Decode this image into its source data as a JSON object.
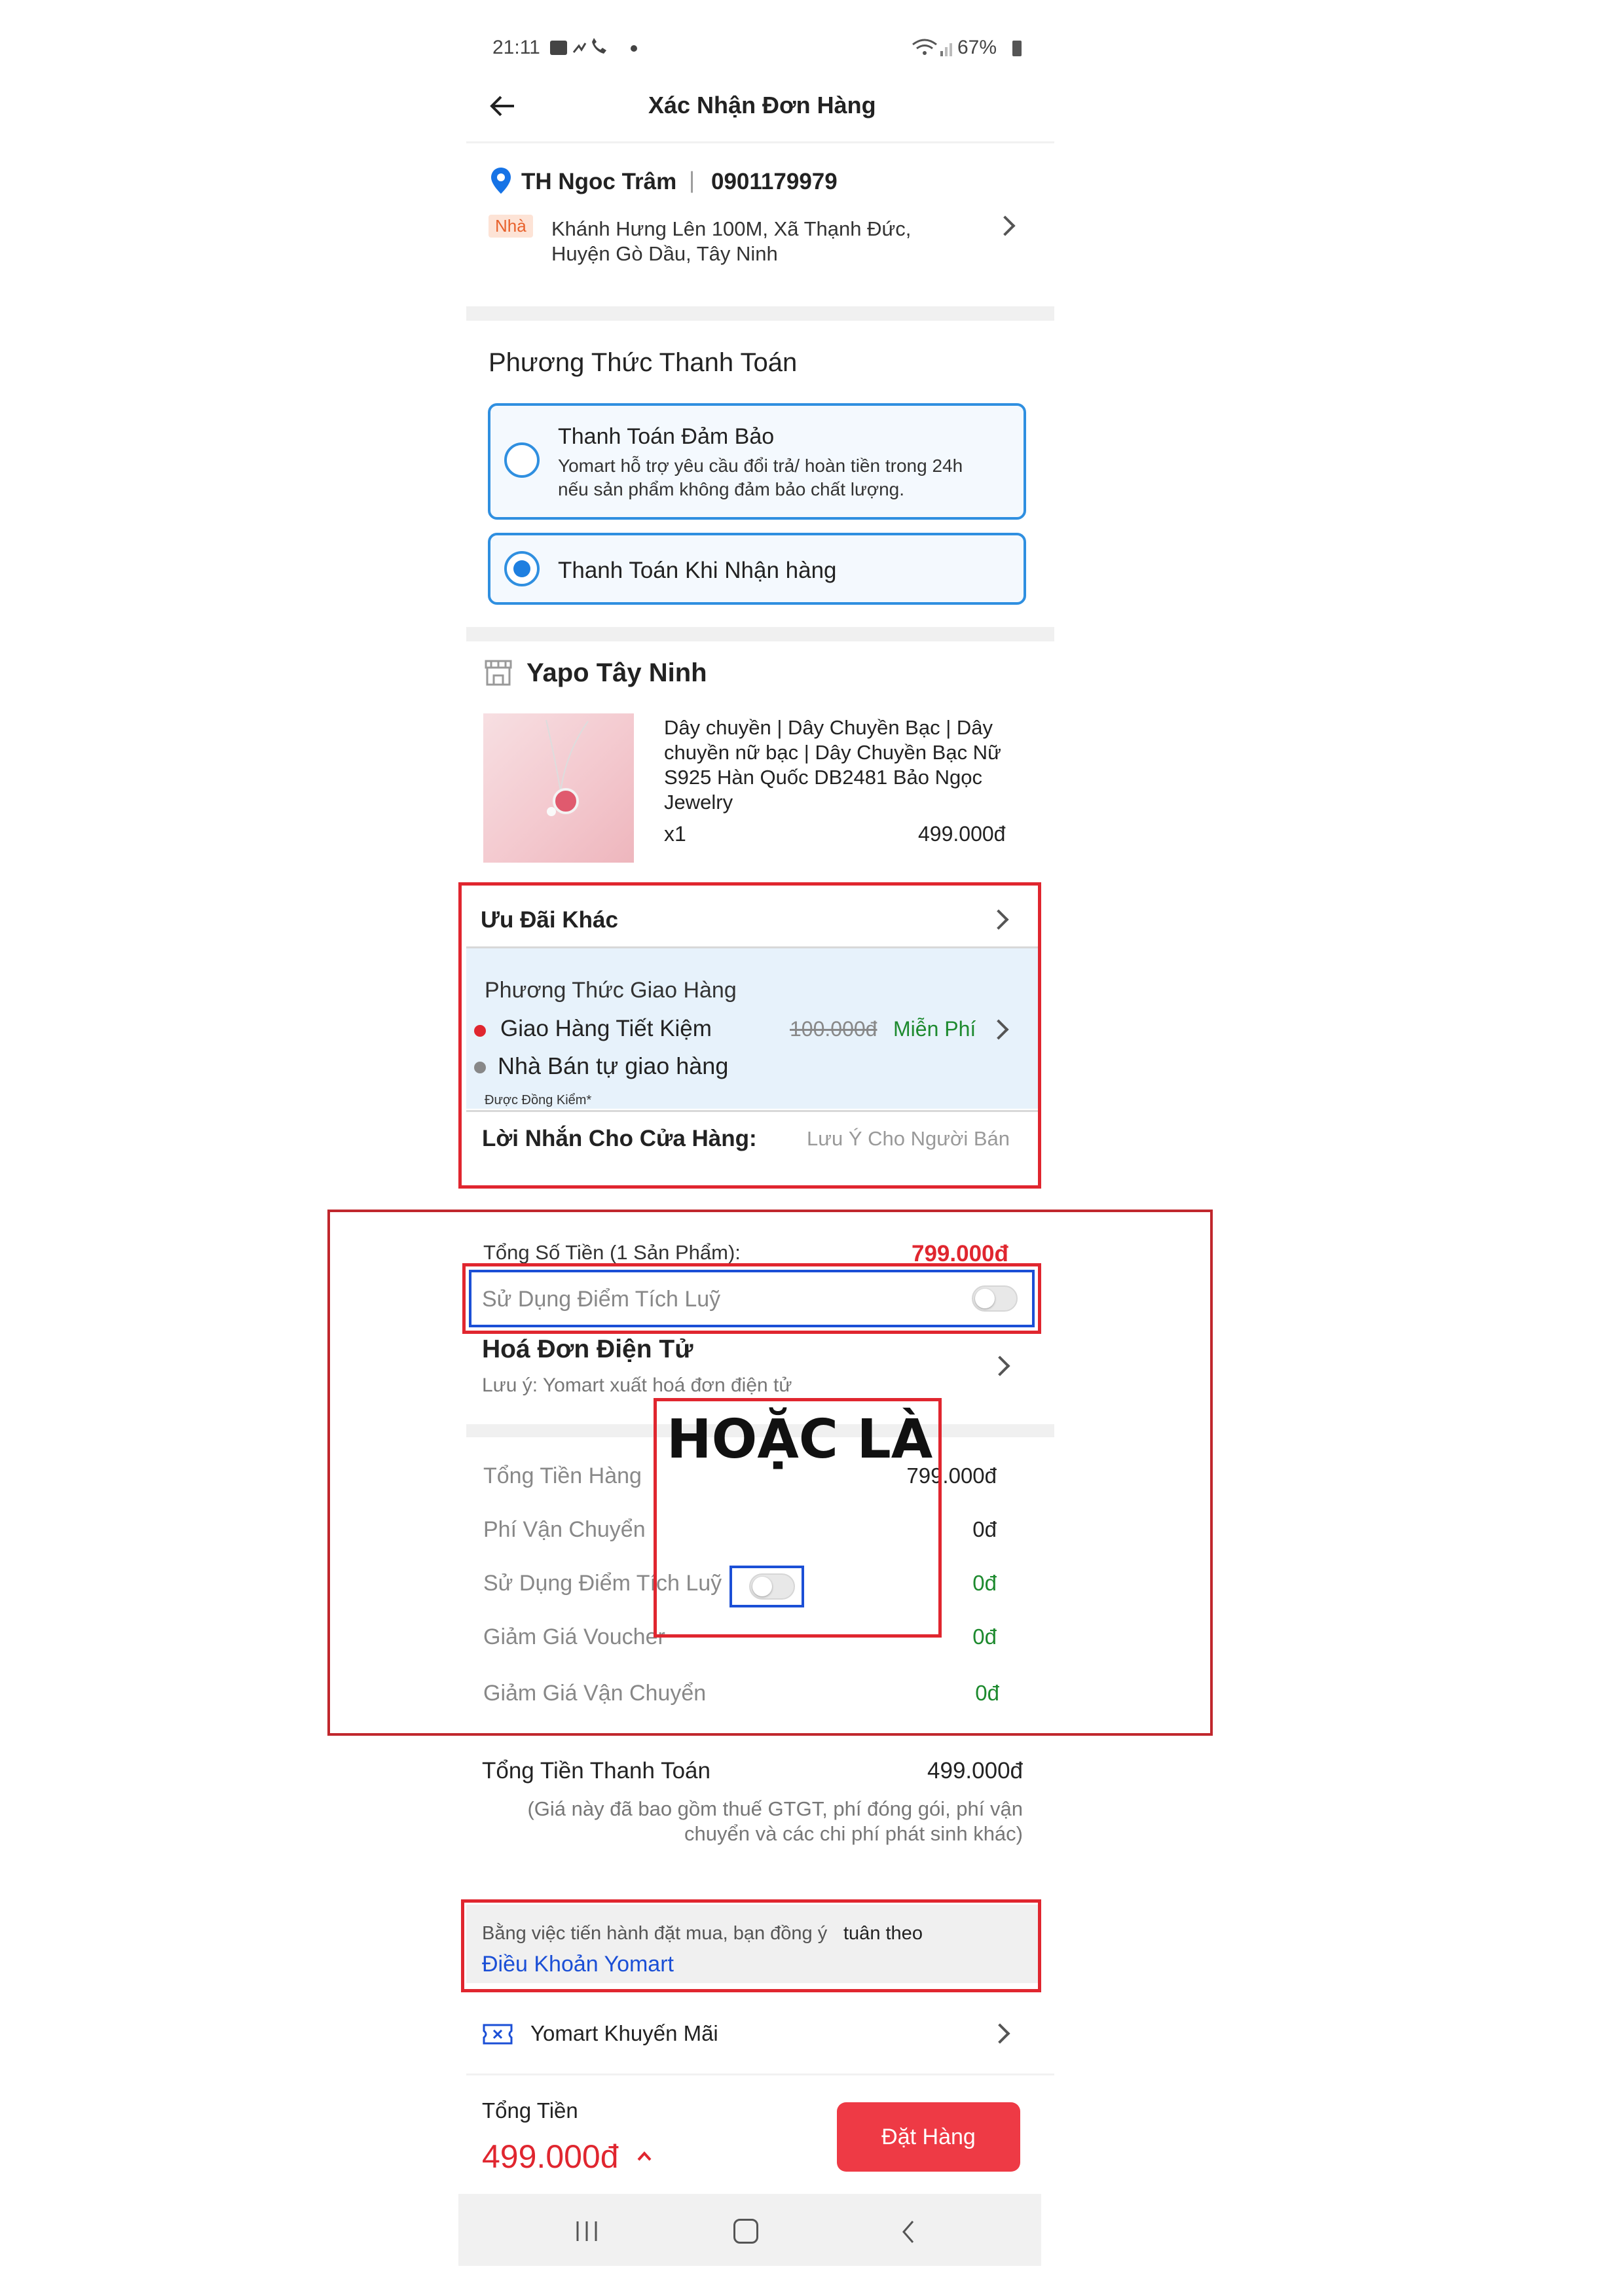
{
  "status_bar": {
    "time": "21:11",
    "icons_left": "image-icon, sim-icon, phone-icon, dot",
    "battery": "67%"
  },
  "header": {
    "title": "Xác Nhận Đơn Hàng"
  },
  "address": {
    "name": "TH Ngoc Trâm",
    "divider": "|",
    "phone": "0901179979",
    "tag": "Nhà",
    "line1": "Khánh Hưng Lên 100M, Xã Thạnh Đức,",
    "line2": "Huyện Gò Dầu, Tây Ninh"
  },
  "payment": {
    "title": "Phương Thức Thanh Toán",
    "options": [
      {
        "label": "Thanh Toán Đảm Bảo",
        "desc1": "Yomart hỗ trợ yêu cầu đổi trả/ hoàn tiền trong 24h",
        "desc2": "nếu sản phẩm không đảm bảo chất lượng.",
        "selected": false
      },
      {
        "label": "Thanh Toán Khi Nhận hàng",
        "selected": true
      }
    ]
  },
  "shop": {
    "name": "Yapo Tây Ninh",
    "product": {
      "title_lines": [
        "Dây chuyền | Dây Chuyền Bạc | Dây",
        "chuyền nữ bạc | Dây Chuyền Bạc Nữ",
        "S925 Hàn Quốc DB2481 Bảo Ngọc",
        "Jewelry"
      ],
      "qty": "x1",
      "price": "499.000đ"
    }
  },
  "offers": {
    "title": "Ưu Đãi Khác"
  },
  "shipping": {
    "title": "Phương Thức Giao Hàng",
    "option1": "Giao Hàng Tiết Kiệm",
    "old_price": "100.000đ",
    "free": "Miễn Phí",
    "option2": "Nhà Bán tự giao hàng",
    "note": "Được Đồng Kiểm*",
    "dot_colors": {
      "option1": "#e0262f",
      "option2": "#888888"
    }
  },
  "message": {
    "label": "Lời Nhắn Cho Cửa Hàng:",
    "placeholder": "Lưu Ý Cho Người Bán"
  },
  "totals": {
    "sum_label": "Tổng Số Tiền (1 Sản Phẩm):",
    "sum_value": "799.000đ",
    "points_label": "Sử Dụng Điểm Tích Luỹ",
    "invoice_title": "Hoá Đơn Điện Tử",
    "invoice_note": "Lưu ý: Yomart xuất hoá đơn điện tử",
    "annotation": "HOẶC LÀ"
  },
  "breakdown": [
    {
      "label": "Tổng Tiền Hàng",
      "value": "799.000đ"
    },
    {
      "label": "Phí Vận Chuyển",
      "value": "0đ"
    },
    {
      "label": "Sử Dụng Điểm Tích Luỹ",
      "value": "0đ"
    },
    {
      "label": "Giảm Giá Voucher",
      "value": "0đ"
    },
    {
      "label": "Giảm Giá Vận Chuyển",
      "value": "0đ"
    }
  ],
  "payable": {
    "label": "Tổng Tiền Thanh Toán",
    "value": "499.000đ",
    "note1": "(Giá này đã bao gồm thuế GTGT, phí đóng gói, phí vận",
    "note2": "chuyển và các chi phí phát sinh khác)"
  },
  "terms": {
    "text": "Bằng việc tiến hành đặt mua, bạn đồng ý",
    "tail": "tuân theo",
    "link": "Điều Khoản Yomart"
  },
  "promo": {
    "label": "Yomart Khuyến Mãi"
  },
  "footer": {
    "total_label": "Tổng Tiền",
    "total_value": "499.000đ",
    "order_button": "Đặt Hàng"
  },
  "colors": {
    "accent_red": "#e0262f",
    "button_red": "#ee3a45",
    "blue": "#2f8fe0",
    "green": "#1d8a2e"
  }
}
